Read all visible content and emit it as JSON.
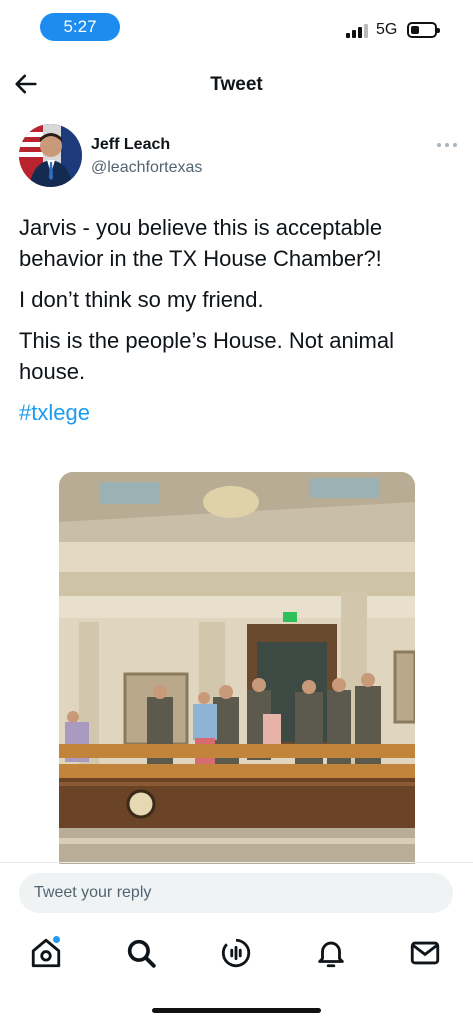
{
  "status": {
    "time": "5:27",
    "network": "5G"
  },
  "header": {
    "title": "Tweet"
  },
  "author": {
    "name": "Jeff Leach",
    "handle": "@leachfortexas"
  },
  "tweet": {
    "paragraphs": [
      "Jarvis - you believe this is acceptable behavior in the TX House Chamber?!",
      "I don’t think so my friend.",
      "This is the people’s House. Not animal house."
    ],
    "hashtag": "#txlege"
  },
  "reply": {
    "placeholder": "Tweet your reply"
  },
  "nav": {
    "items": [
      "home-icon",
      "search-icon",
      "spaces-icon",
      "notifications-icon",
      "messages-icon"
    ]
  },
  "colors": {
    "accent": "#1d9bf0",
    "time_pill": "#1d8cf0"
  }
}
